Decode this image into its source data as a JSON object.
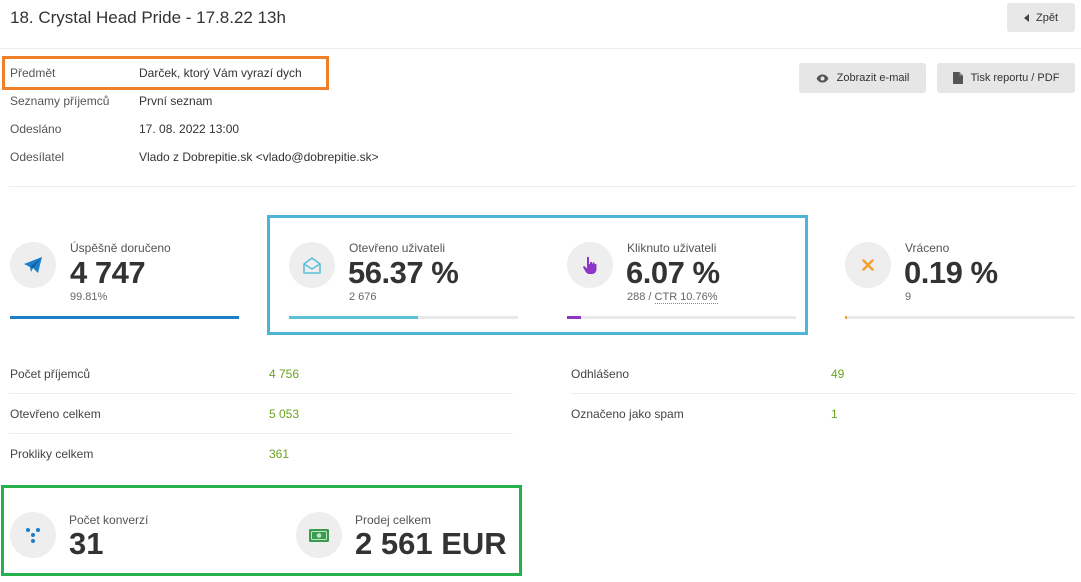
{
  "header": {
    "title": "18. Crystal Head Pride - 17.8.22 13h",
    "back_label": "Zpět"
  },
  "meta": [
    {
      "label": "Předmět",
      "value": "Darček, ktorý Vám vyrazí dych"
    },
    {
      "label": "Seznamy příjemců",
      "value": "První seznam"
    },
    {
      "label": "Odesláno",
      "value": "17. 08. 2022 13:00"
    },
    {
      "label": "Odesílatel",
      "value": "Vlado z Dobrepitie.sk <vlado@dobrepitie.sk>"
    }
  ],
  "actions": {
    "view_email": "Zobrazit e-mail",
    "print_report": "Tisk reportu / PDF"
  },
  "stats": [
    {
      "label": "Úspěšně doručeno",
      "value": "4 747",
      "sub": "99.81%",
      "icon": "paper-plane-icon",
      "color": "#1e7fc9",
      "fill": 1.0
    },
    {
      "label": "Otevřeno uživateli",
      "value": "56.37 %",
      "sub": "2 676",
      "icon": "envelope-open-icon",
      "color": "#5bc0d8",
      "fill": 0.5637
    },
    {
      "label": "Kliknuto uživateli",
      "value": "6.07 %",
      "sub_prefix": "288 / ",
      "sub_link": "CTR 10.76%",
      "icon": "pointer-hand-icon",
      "color": "#8e35c9",
      "fill": 0.0607
    },
    {
      "label": "Vráceno",
      "value": "0.19 %",
      "sub": "9",
      "icon": "x-icon",
      "color": "#f0a030",
      "fill": 0.0019
    }
  ],
  "table_left": [
    {
      "label": "Počet příjemců",
      "value": "4 756"
    },
    {
      "label": "Otevřeno celkem",
      "value": "5 053"
    },
    {
      "label": "Prokliky celkem",
      "value": "361"
    }
  ],
  "table_right": [
    {
      "label": "Odhlášeno",
      "value": "49"
    },
    {
      "label": "Označeno jako spam",
      "value": "1"
    }
  ],
  "conversions": [
    {
      "label": "Počet konverzí",
      "value": "31",
      "icon": "funnel-dots-icon"
    },
    {
      "label": "Prodej celkem",
      "value": "2 561 EUR",
      "icon": "banknote-icon"
    }
  ]
}
